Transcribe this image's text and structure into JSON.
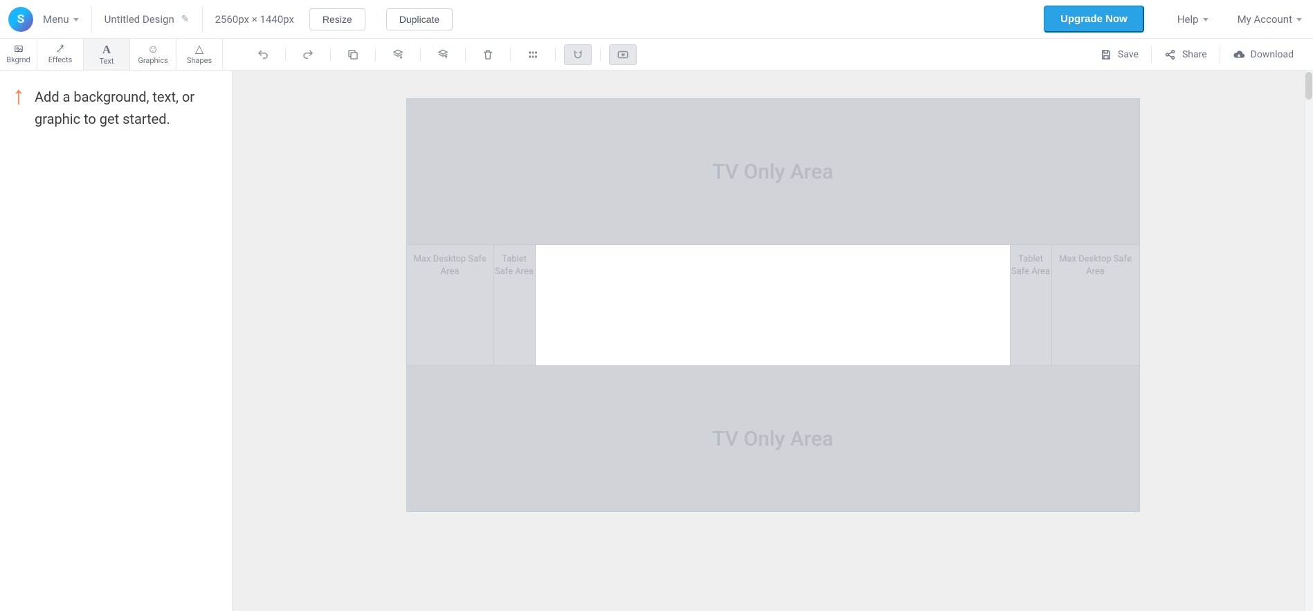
{
  "brand": {
    "letter": "S"
  },
  "top": {
    "menu": "Menu",
    "title": "Untitled Design",
    "dimensions": "2560px × 1440px",
    "resize": "Resize",
    "duplicate": "Duplicate",
    "upgrade": "Upgrade Now",
    "help": "Help",
    "account": "My Account"
  },
  "tools": {
    "bkgrnd": "Bkgrnd",
    "effects": "Effects",
    "text": "Text",
    "graphics": "Graphics",
    "shapes": "Shapes"
  },
  "actions": {
    "save": "Save",
    "share": "Share",
    "download": "Download"
  },
  "sidepanel": {
    "hint": "Add a background, text, or graphic to get started."
  },
  "canvas": {
    "tv_area": "TV Only Area",
    "max_desktop": "Max Desktop Safe Area",
    "tablet": "Tablet Safe Area"
  }
}
